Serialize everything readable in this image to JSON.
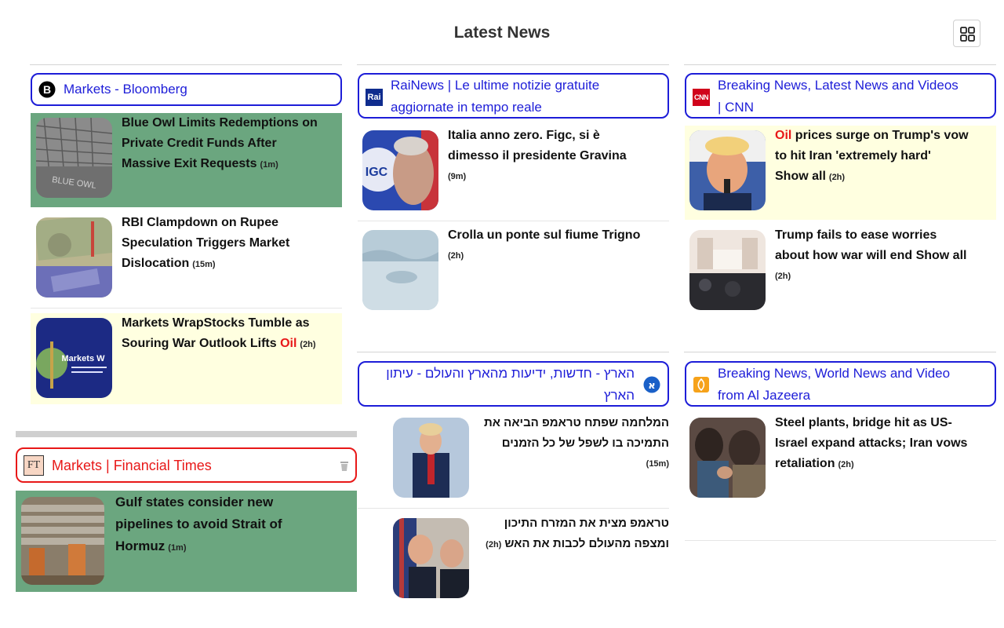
{
  "page": {
    "title": "Latest News"
  },
  "grid_button": {
    "icon": "grid-icon"
  },
  "sources": {
    "bloomberg": {
      "name": "Markets - Bloomberg",
      "logo": "bloomberg-logo-icon",
      "articles": [
        {
          "line1": "Blue Owl Limits Redemptions on",
          "line2": "Private Credit Funds After",
          "line3": "Massive Exit Requests",
          "age": "(1m)",
          "bg": "green"
        },
        {
          "line1": "RBI Clampdown on Rupee",
          "line2": "Speculation Triggers Market",
          "line3": "Dislocation",
          "age": "(15m)",
          "bg": "white"
        },
        {
          "line1": "Markets WrapStocks Tumble as",
          "line2a": "Souring War Outlook Lifts ",
          "keyword": "Oil",
          "age": "(2h)",
          "bg": "yellow"
        }
      ]
    },
    "rainews": {
      "name_line1": "RaiNews | Le ultime notizie gratuite",
      "name_line2": "aggiornate in tempo reale",
      "logo_text": "Rai",
      "articles": [
        {
          "line1": "Italia anno zero. Figc, si è",
          "line2": "dimesso il presidente Gravina",
          "age": "(9m)"
        },
        {
          "line1": "Crolla un ponte sul fiume Trigno",
          "age": "(2h)"
        }
      ]
    },
    "cnn": {
      "name_line1": "Breaking News, Latest News and Videos",
      "name_line2": "| CNN",
      "logo_text": "CNN",
      "articles": [
        {
          "keyword": "Oil",
          "line1_rest": " prices surge on Trump's vow",
          "line2": "to hit Iran 'extremely hard'",
          "line3": "Show all",
          "age": "(2h)",
          "bg": "yellow"
        },
        {
          "line1": "Trump fails to ease worries",
          "line2": "about how war will end Show all",
          "age": "(2h)",
          "bg": "white"
        }
      ]
    },
    "haaretz": {
      "name_line1": "הארץ - חדשות, ידיעות מהארץ והעולם - עיתון",
      "name_line2": "הארץ",
      "logo": "haaretz-logo-icon",
      "articles": [
        {
          "line1": "המלחמה שפתח טראמפ הביאה את",
          "line2": "התמיכה בו לשפל של כל הזמנים",
          "age": "(15m)"
        },
        {
          "line1": "טראמפ מצית את המזרח התיכון",
          "line2": "ומצפה מהעולם לכבות את האש",
          "age": "(2h)"
        }
      ]
    },
    "aljazeera": {
      "name_line1": "Breaking News, World News and Video",
      "name_line2": "from Al Jazeera",
      "logo": "aljazeera-logo-icon",
      "articles": [
        {
          "line1": "Steel plants, bridge hit as US-",
          "line2": "Israel expand attacks; Iran vows",
          "line3": "retaliation",
          "age": "(2h)"
        }
      ]
    },
    "ft": {
      "name": "Markets | Financial Times",
      "logo_text": "FT",
      "delete_icon": "trash-icon",
      "articles": [
        {
          "line1": "Gulf states consider new",
          "line2": "pipelines to avoid Strait of",
          "line3": "Hormuz",
          "age": "(1m)",
          "bg": "green"
        }
      ]
    }
  },
  "colors": {
    "link_blue": "#1d1dd8",
    "alert_red": "#e81818",
    "green_card": "#6ba67f",
    "yellow_card": "#ffffe0"
  }
}
